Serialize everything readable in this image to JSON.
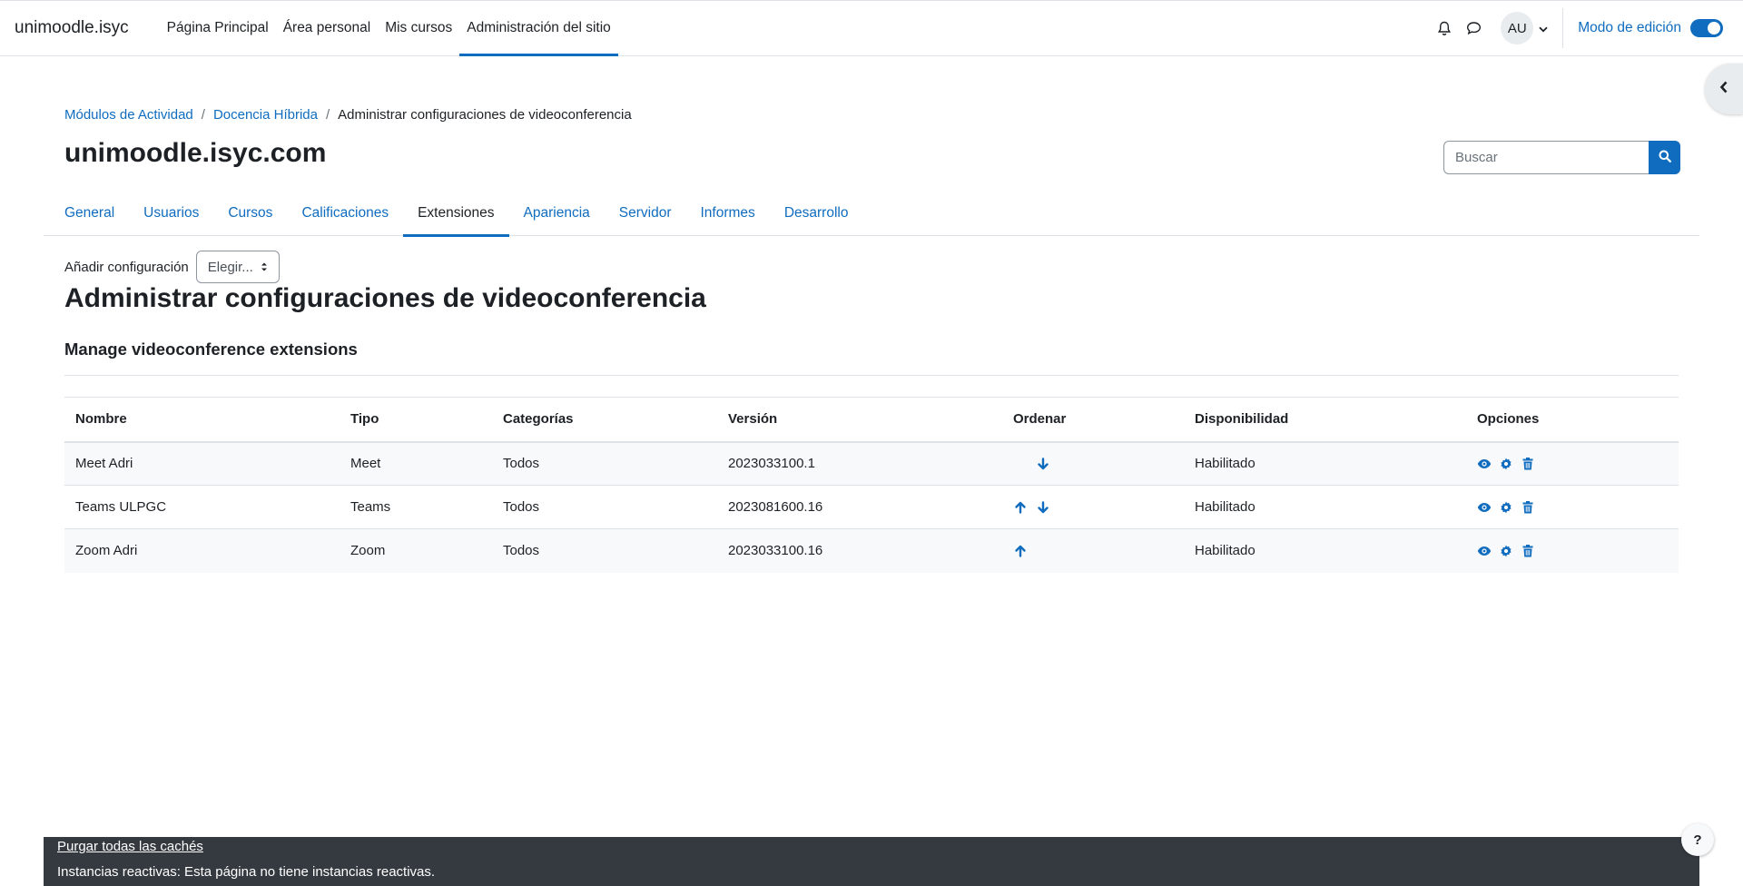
{
  "navbar": {
    "brand": "unimoodle.isyc",
    "items": [
      {
        "label": "Página Principal"
      },
      {
        "label": "Área personal"
      },
      {
        "label": "Mis cursos"
      },
      {
        "label": "Administración del sitio"
      }
    ],
    "avatar_initials": "AU",
    "edit_mode_label": "Modo de edición",
    "edit_mode_on": true
  },
  "breadcrumb": [
    {
      "label": "Módulos de Actividad"
    },
    {
      "label": "Docencia Híbrida"
    },
    {
      "label": "Administrar configuraciones de videoconferencia"
    }
  ],
  "page_heading": "unimoodle.isyc.com",
  "search": {
    "placeholder": "Buscar"
  },
  "tabs": [
    {
      "label": "General"
    },
    {
      "label": "Usuarios"
    },
    {
      "label": "Cursos"
    },
    {
      "label": "Calificaciones"
    },
    {
      "label": "Extensiones"
    },
    {
      "label": "Apariencia"
    },
    {
      "label": "Servidor"
    },
    {
      "label": "Informes"
    },
    {
      "label": "Desarrollo"
    }
  ],
  "add_config": {
    "label": "Añadir configuración",
    "selected": "Elegir..."
  },
  "main_title": "Administrar configuraciones de videoconferencia",
  "section_title": "Manage videoconference extensions",
  "table": {
    "headers": [
      "Nombre",
      "Tipo",
      "Categorías",
      "Versión",
      "Ordenar",
      "Disponibilidad",
      "Opciones"
    ],
    "rows": [
      {
        "name": "Meet Adri",
        "type": "Meet",
        "categories": "Todos",
        "version": "2023033100.1",
        "availability": "Habilitado"
      },
      {
        "name": "Teams ULPGC",
        "type": "Teams",
        "categories": "Todos",
        "version": "2023081600.16",
        "availability": "Habilitado"
      },
      {
        "name": "Zoom Adri",
        "type": "Zoom",
        "categories": "Todos",
        "version": "2023033100.16",
        "availability": "Habilitado"
      }
    ]
  },
  "footer": {
    "purge_link": "Purgar todas las cachés",
    "reactive_text": "Instancias reactivas: Esta página no tiene instancias reactivas."
  },
  "help_label": "?",
  "colors": {
    "accent": "#0f6cbf",
    "text": "#1d2125",
    "footer_bg": "#343a40"
  },
  "icons": [
    "bell-icon",
    "chat-icon",
    "chevron-down-icon",
    "chevron-left-icon",
    "search-icon",
    "arrow-up-icon",
    "arrow-down-icon",
    "eye-icon",
    "gear-icon",
    "trash-icon"
  ]
}
